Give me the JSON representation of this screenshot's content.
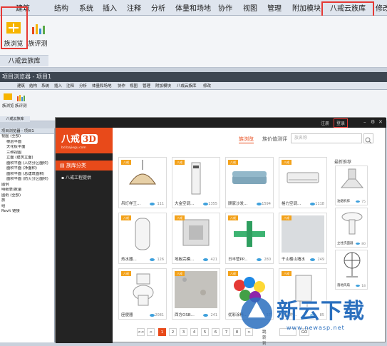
{
  "ribbon": {
    "tabs": [
      "建筑",
      "结构",
      "系统",
      "插入",
      "注释",
      "分析",
      "体量和场地",
      "协作",
      "视图",
      "管理",
      "附加模块",
      "八戒云族库",
      "修改"
    ],
    "active_tab": "八戒云族库",
    "buttons": [
      "族浏览",
      "族评测"
    ],
    "group_label": "八戒云族库"
  },
  "mini": {
    "title": "项目浏览器 - 项目1",
    "tabs": [
      "建筑",
      "结构",
      "系统",
      "插入",
      "注释",
      "分析",
      "体量和场地",
      "协作",
      "视图",
      "管理",
      "附加模块",
      "八戒云族库",
      "修改"
    ],
    "buttons": [
      "族浏览",
      "族评测"
    ],
    "group_label": "八戒云族库"
  },
  "project_browser": {
    "header": "项目浏览器 - 项目1",
    "rows": [
      "视图 (全部)",
      "楼层平面",
      "天花板平面",
      "三维视图",
      "立面 (建筑立面)",
      "面积平面 (人防分区面积)",
      "面积平面 (净面积)",
      "面积平面 (总建筑面积)",
      "面积平面 (防火分区面积)",
      "图例",
      "明细表/数量",
      "图纸 (全部)",
      "族",
      "组",
      "Revit 链接"
    ]
  },
  "library": {
    "logo_text": "八戒",
    "logo_3d": "3D",
    "logo_url": "bd.bajiegu.com",
    "title_links": [
      "注册",
      "登录"
    ],
    "side_header": "族库分类",
    "side_item": "八戒工程提供",
    "search_tabs": [
      "族浏览",
      "族价值测评"
    ],
    "search_placeholder": "族名称",
    "recommend_title": "最新推荐",
    "cards": [
      {
        "name": "吊灯样王...",
        "count": "111"
      },
      {
        "name": "大金空调...",
        "count": "1355"
      },
      {
        "name": "顾家沙发...",
        "count": "1594"
      },
      {
        "name": "格力空调...",
        "count": "1118"
      },
      {
        "name": "热水器...",
        "count": "126"
      },
      {
        "name": "地板完模...",
        "count": "421"
      },
      {
        "name": "日丰管PP...",
        "count": "280"
      },
      {
        "name": "干山楼山墙水",
        "count": "249"
      },
      {
        "name": "座便器",
        "count": "2081"
      },
      {
        "name": "西方OSB...",
        "count": "241"
      },
      {
        "name": "优彩涂料...",
        "count": "57"
      },
      {
        "name": "壁挂炉...",
        "count": "85"
      }
    ],
    "recommend": [
      {
        "name": "油烟机排",
        "count": "75"
      },
      {
        "name": "立柱洗面器",
        "count": "80"
      },
      {
        "name": "落地风扇",
        "count": "18"
      }
    ],
    "pager": {
      "prev": "<<",
      "prev1": "<",
      "pages": [
        "1",
        "2",
        "3",
        "4",
        "5",
        "6",
        "7",
        "8"
      ],
      "next": ">",
      "jump_label": "跳转到",
      "go": "GO"
    }
  },
  "watermark": {
    "text": "新云下载",
    "url": "www.newasp.net"
  }
}
